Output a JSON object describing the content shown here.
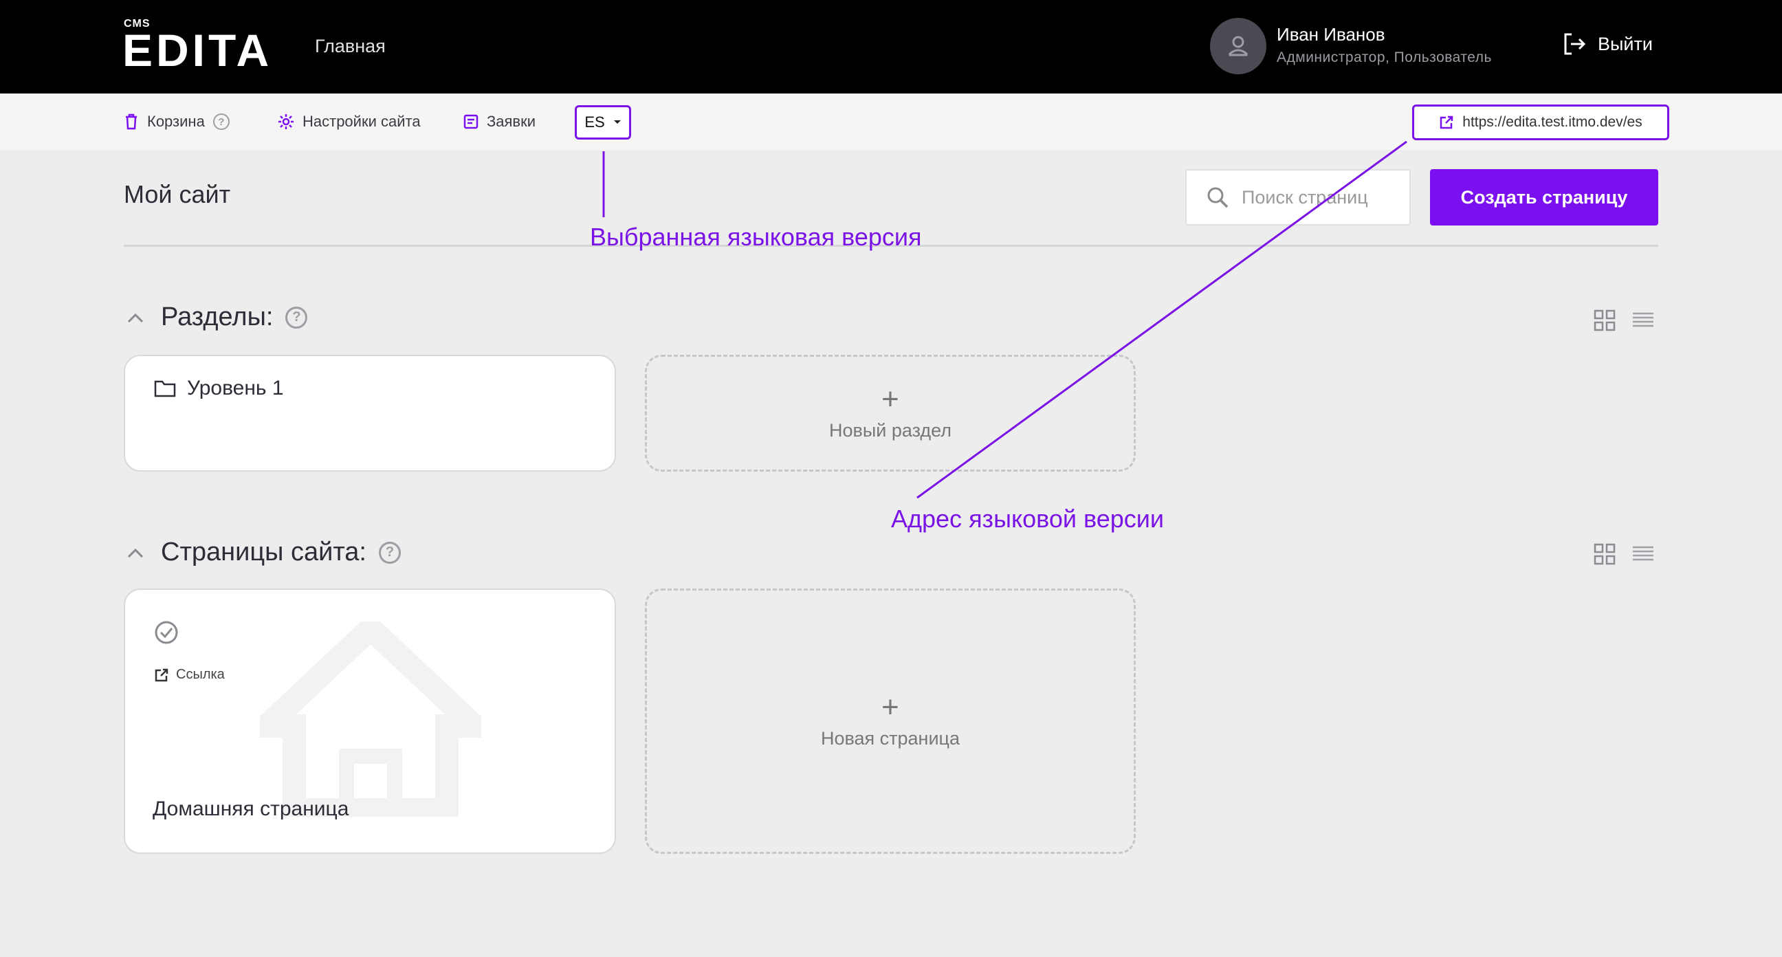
{
  "header": {
    "logo_small": "CMS",
    "logo": "EDITA",
    "nav_home": "Главная",
    "user_name": "Иван Иванов",
    "user_role": "Администратор, Пользователь",
    "logout_label": "Выйти"
  },
  "toolbar": {
    "trash_label": "Корзина",
    "settings_label": "Настройки сайта",
    "requests_label": "Заявки",
    "language": "ES",
    "site_url": "https://edita.test.itmo.dev/es"
  },
  "page": {
    "title": "Мой сайт",
    "search_placeholder": "Поиск страниц",
    "create_button": "Создать страницу"
  },
  "sections": {
    "title": "Разделы:",
    "items": [
      {
        "label": "Уровень 1"
      }
    ],
    "new_label": "Новый раздел"
  },
  "pages": {
    "title": "Страницы сайта:",
    "items": [
      {
        "link_label": "Ссылка",
        "label": "Домашняя страница"
      }
    ],
    "new_label": "Новая страница"
  },
  "annotations": {
    "language_version": "Выбранная языковая версия",
    "language_address": "Адрес языковой версии"
  },
  "colors": {
    "accent": "#7a0ff0",
    "annotation": "#7a13e6",
    "header_bg": "#000000",
    "page_bg": "#ededed"
  }
}
